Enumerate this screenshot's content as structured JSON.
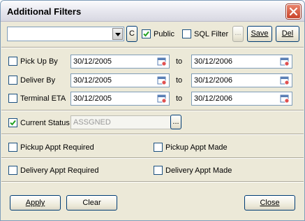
{
  "window": {
    "title": "Additional Filters"
  },
  "toolbar": {
    "filter_combo_value": "",
    "c_label": "C",
    "public_label": "Public",
    "public_checked": true,
    "sql_filter_label": "SQL Filter",
    "sql_filter_checked": false,
    "ellipsis_label": "...",
    "save_label": "Save",
    "del_label": "Del"
  },
  "dates": {
    "to_label": "to",
    "rows": [
      {
        "label": "Pick Up By",
        "from": "30/12/2005",
        "to": "30/12/2006",
        "checked": false
      },
      {
        "label": "Deliver By",
        "from": "30/12/2005",
        "to": "30/12/2006",
        "checked": false
      },
      {
        "label": "Terminal ETA",
        "from": "30/12/2005",
        "to": "30/12/2006",
        "checked": false
      }
    ]
  },
  "status": {
    "label": "Current Status",
    "checked": true,
    "value": "ASSGNED",
    "ellipsis_label": "..."
  },
  "appointments": {
    "pickup_required": "Pickup Appt Required",
    "pickup_made": "Pickup Appt Made",
    "delivery_required": "Delivery Appt Required",
    "delivery_made": "Delivery Appt Made"
  },
  "footer": {
    "apply_label": "Apply",
    "clear_label": "Clear",
    "close_label": "Close"
  }
}
